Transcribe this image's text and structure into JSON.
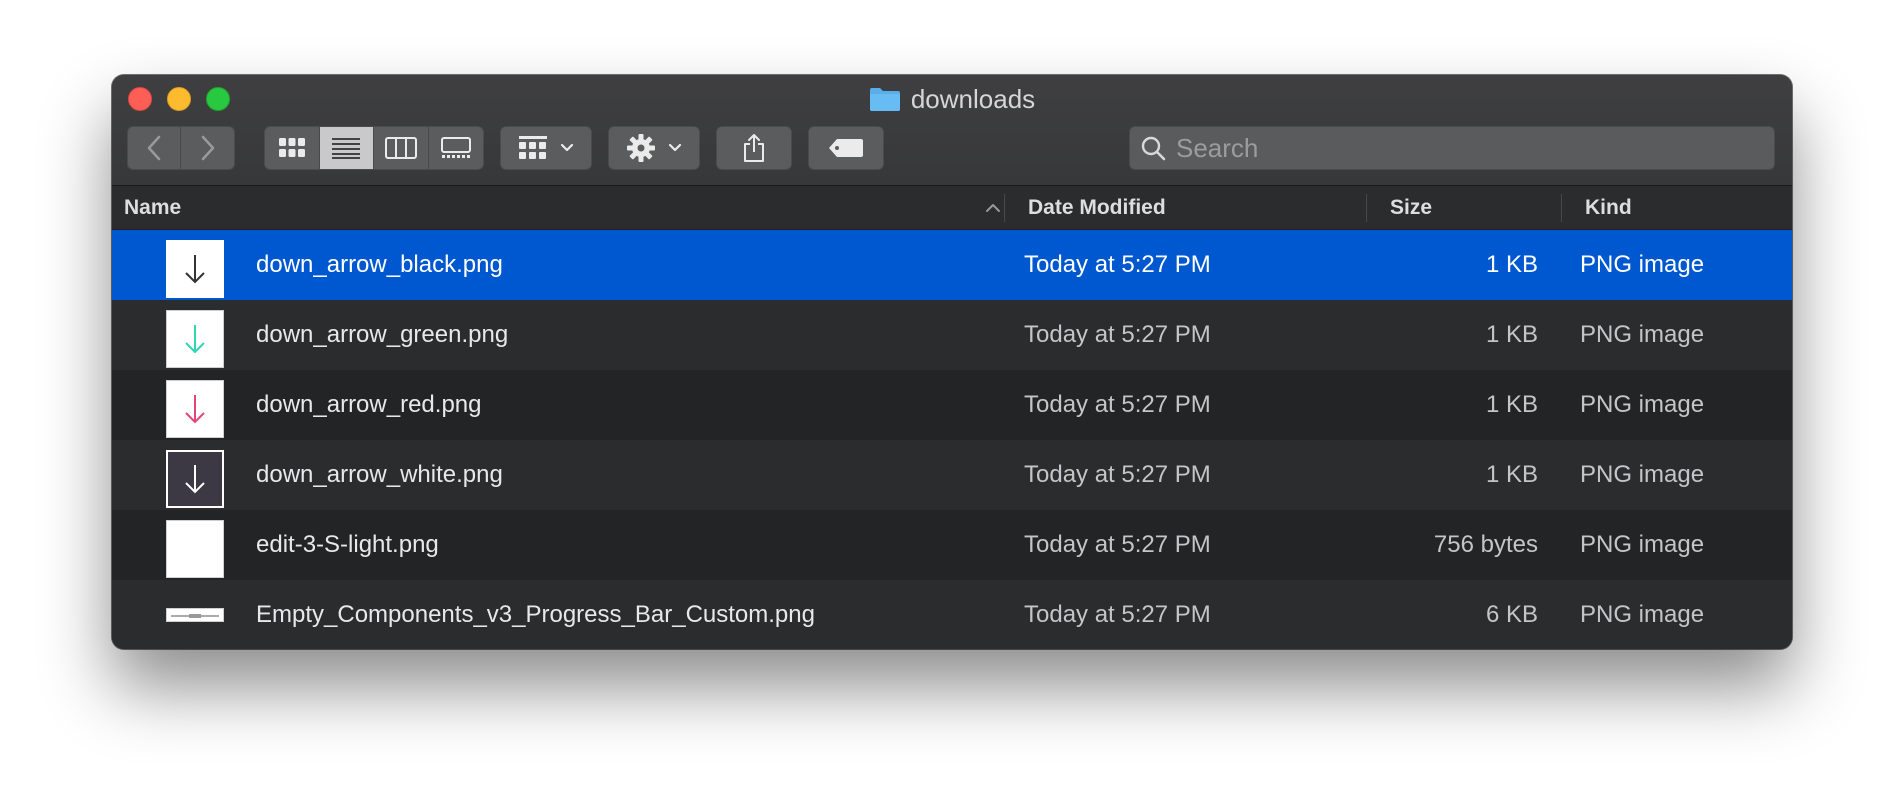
{
  "window": {
    "title": "downloads"
  },
  "search": {
    "placeholder": "Search"
  },
  "columns": {
    "name": "Name",
    "date": "Date Modified",
    "size": "Size",
    "kind": "Kind"
  },
  "files": [
    {
      "name": "down_arrow_black.png",
      "date": "Today at 5:27 PM",
      "size": "1 KB",
      "kind": "PNG image",
      "thumb": "down-arrow-black-icon",
      "selected": true
    },
    {
      "name": "down_arrow_green.png",
      "date": "Today at 5:27 PM",
      "size": "1 KB",
      "kind": "PNG image",
      "thumb": "down-arrow-green-icon",
      "selected": false
    },
    {
      "name": "down_arrow_red.png",
      "date": "Today at 5:27 PM",
      "size": "1 KB",
      "kind": "PNG image",
      "thumb": "down-arrow-red-icon",
      "selected": false
    },
    {
      "name": "down_arrow_white.png",
      "date": "Today at 5:27 PM",
      "size": "1 KB",
      "kind": "PNG image",
      "thumb": "down-arrow-white-icon",
      "selected": false
    },
    {
      "name": "edit-3-S-light.png",
      "date": "Today at 5:27 PM",
      "size": "756 bytes",
      "kind": "PNG image",
      "thumb": "blank-image-icon",
      "selected": false
    },
    {
      "name": "Empty_Components_v3_Progress_Bar_Custom.png",
      "date": "Today at 5:27 PM",
      "size": "6 KB",
      "kind": "PNG image",
      "thumb": "progress-bar-image-icon",
      "selected": false
    }
  ],
  "colors": {
    "selection": "#0058d0",
    "folder": "#5aaee8",
    "arrow_green": "#2fd6b4",
    "arrow_red": "#e8447c",
    "traffic_red": "#fd5f57",
    "traffic_yellow": "#febb2e",
    "traffic_green": "#28c840"
  }
}
